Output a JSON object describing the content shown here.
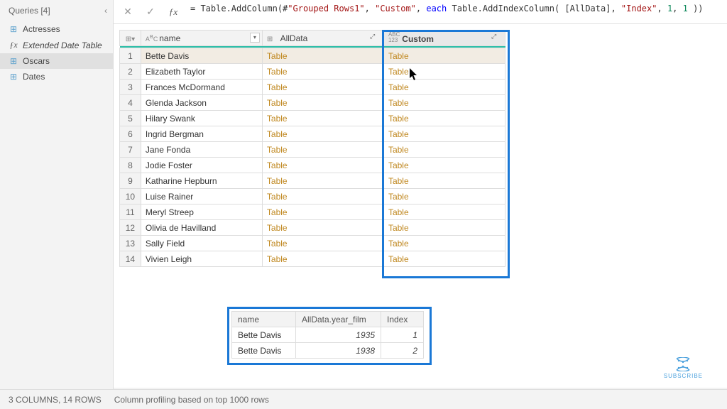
{
  "sidebar": {
    "title": "Queries [4]",
    "items": [
      {
        "icon_name": "table-icon",
        "label": "Actresses",
        "italic": false
      },
      {
        "icon_name": "fx-icon",
        "label": "Extended Date Table",
        "italic": true
      },
      {
        "icon_name": "table-icon",
        "label": "Oscars",
        "italic": false,
        "selected": true
      },
      {
        "icon_name": "table-icon",
        "label": "Dates",
        "italic": false
      }
    ]
  },
  "formula_bar": {
    "prefix": "= Table.AddColumn(#",
    "str1": "\"Grouped Rows1\"",
    "sep1": ", ",
    "str2": "\"Custom\"",
    "sep2": ", ",
    "kw_each": "each",
    "mid": " Table.AddIndexColumn( [AllData], ",
    "str3": "\"Index\"",
    "sep3": ", ",
    "num1": "1",
    "sep4": ", ",
    "num2": "1",
    "suffix": " ))"
  },
  "grid": {
    "columns": {
      "name": {
        "label": "name",
        "type_icon": "ABC"
      },
      "alldata": {
        "label": "AllData",
        "type_icon": "⊞"
      },
      "custom": {
        "label": "Custom",
        "type_icon": "ABC/123"
      }
    },
    "rows": [
      {
        "n": "1",
        "name": "Bette Davis",
        "alldata": "Table",
        "custom": "Table"
      },
      {
        "n": "2",
        "name": "Elizabeth Taylor",
        "alldata": "Table",
        "custom": "Table"
      },
      {
        "n": "3",
        "name": "Frances McDormand",
        "alldata": "Table",
        "custom": "Table"
      },
      {
        "n": "4",
        "name": "Glenda Jackson",
        "alldata": "Table",
        "custom": "Table"
      },
      {
        "n": "5",
        "name": "Hilary Swank",
        "alldata": "Table",
        "custom": "Table"
      },
      {
        "n": "6",
        "name": "Ingrid Bergman",
        "alldata": "Table",
        "custom": "Table"
      },
      {
        "n": "7",
        "name": "Jane Fonda",
        "alldata": "Table",
        "custom": "Table"
      },
      {
        "n": "8",
        "name": "Jodie Foster",
        "alldata": "Table",
        "custom": "Table"
      },
      {
        "n": "9",
        "name": "Katharine Hepburn",
        "alldata": "Table",
        "custom": "Table"
      },
      {
        "n": "10",
        "name": "Luise Rainer",
        "alldata": "Table",
        "custom": "Table"
      },
      {
        "n": "11",
        "name": "Meryl Streep",
        "alldata": "Table",
        "custom": "Table"
      },
      {
        "n": "12",
        "name": "Olivia de Havilland",
        "alldata": "Table",
        "custom": "Table"
      },
      {
        "n": "13",
        "name": "Sally Field",
        "alldata": "Table",
        "custom": "Table"
      },
      {
        "n": "14",
        "name": "Vivien Leigh",
        "alldata": "Table",
        "custom": "Table"
      }
    ]
  },
  "preview": {
    "columns": [
      "name",
      "AllData.year_film",
      "Index"
    ],
    "rows": [
      {
        "name": "Bette Davis",
        "year": "1935",
        "index": "1"
      },
      {
        "name": "Bette Davis",
        "year": "1938",
        "index": "2"
      }
    ]
  },
  "statusbar": {
    "left": "3 COLUMNS, 14 ROWS",
    "right": "Column profiling based on top 1000 rows"
  },
  "subscribe": "SUBSCRIBE"
}
